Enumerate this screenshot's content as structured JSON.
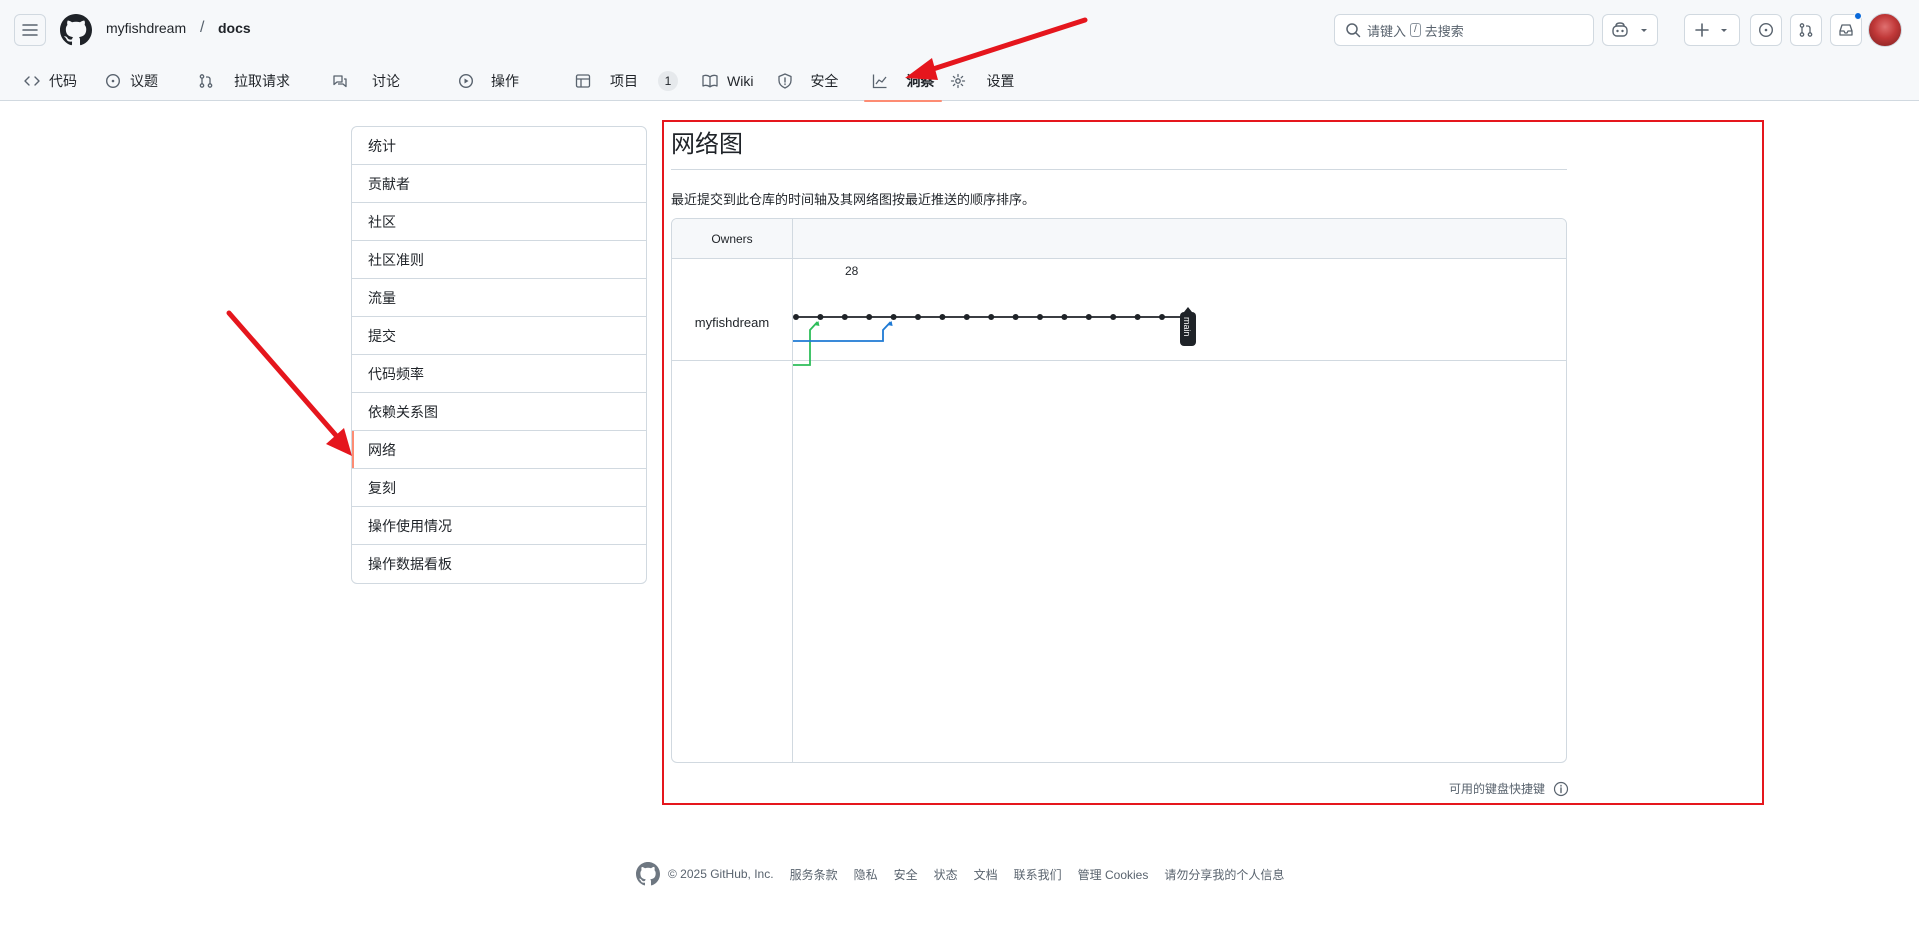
{
  "header": {
    "owner": "myfishdream",
    "separator": "/",
    "repo": "docs",
    "search": {
      "prefix": "请键入",
      "key": "/",
      "suffix": "去搜索"
    }
  },
  "tabs": [
    {
      "label": "代码",
      "icon": "code-icon"
    },
    {
      "label": "议题",
      "icon": "issue-icon"
    },
    {
      "label": "拉取请求",
      "icon": "pull-request-icon"
    },
    {
      "label": "讨论",
      "icon": "discussion-icon"
    },
    {
      "label": "操作",
      "icon": "play-icon"
    },
    {
      "label": "项目",
      "icon": "table-icon",
      "counter": "1"
    },
    {
      "label": "Wiki",
      "icon": "book-icon"
    },
    {
      "label": "安全",
      "icon": "shield-icon"
    },
    {
      "label": "洞察",
      "icon": "graph-icon",
      "selected": true
    },
    {
      "label": "设置",
      "icon": "gear-icon"
    }
  ],
  "sidebar": {
    "items": [
      {
        "label": "统计"
      },
      {
        "label": "贡献者"
      },
      {
        "label": "社区"
      },
      {
        "label": "社区准则"
      },
      {
        "label": "流量"
      },
      {
        "label": "提交"
      },
      {
        "label": "代码频率"
      },
      {
        "label": "依赖关系图"
      },
      {
        "label": "网络",
        "selected": true
      },
      {
        "label": "复刻"
      },
      {
        "label": "操作使用情况"
      },
      {
        "label": "操作数据看板"
      }
    ]
  },
  "main": {
    "title": "网络图",
    "description": "最近提交到此仓库的时间轴及其网络图按最近推送的顺序排序。",
    "graph": {
      "owners_header": "Owners",
      "date_label": "28",
      "owner": "myfishdream",
      "branch_label": "main",
      "main_commit_count": 17,
      "colors": {
        "main": "#1f2328",
        "blue": "#1f7ad4",
        "green": "#2ebd5a"
      }
    },
    "shortcuts": "可用的键盘快捷键"
  },
  "footer": {
    "copyright": "© 2025 GitHub, Inc.",
    "links": [
      "服务条款",
      "隐私",
      "安全",
      "状态",
      "文档",
      "联系我们",
      "管理 Cookies",
      "请勿分享我的个人信息"
    ]
  },
  "annotation_color": "#e5161d"
}
